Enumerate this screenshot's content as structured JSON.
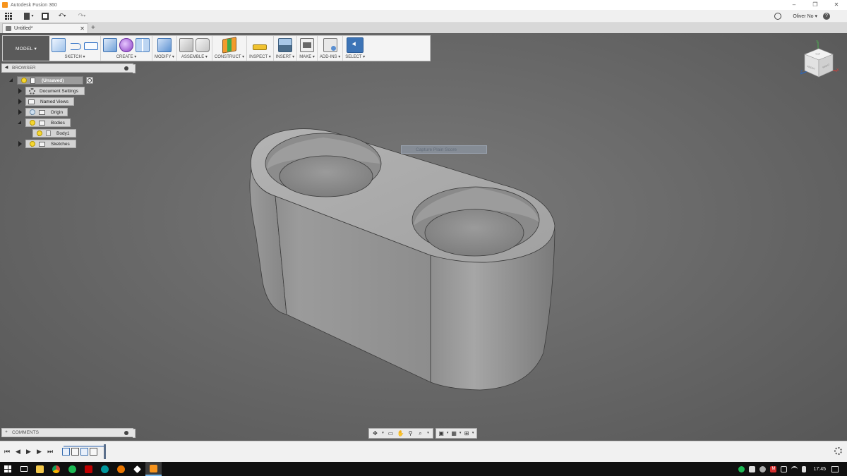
{
  "window": {
    "title": "Autodesk Fusion 360",
    "controls": [
      "–",
      "❐",
      "✕"
    ]
  },
  "quick_access": {
    "user": "Oliver No ▾",
    "help": "?",
    "file_caret": "▾",
    "undo_caret": "▾",
    "redo_caret": "▾"
  },
  "tabs": {
    "doc_tab": "Untitled*",
    "close": "✕",
    "add": "+"
  },
  "toolbar": {
    "workspace": "MODEL ▾",
    "groups": [
      "SKETCH ▾",
      "CREATE ▾",
      "MODIFY ▾",
      "ASSEMBLE ▾",
      "CONSTRUCT ▾",
      "INSPECT ▾",
      "INSERT ▾",
      "MAKE ▾",
      "ADD-INS ▾",
      "SELECT ▾"
    ]
  },
  "browser": {
    "title": "BROWSER",
    "items": [
      {
        "label": "(Unsaved)"
      },
      {
        "label": "Document Settings"
      },
      {
        "label": "Named Views"
      },
      {
        "label": "Origin"
      },
      {
        "label": "Bodies"
      },
      {
        "label": "Body1"
      },
      {
        "label": "Sketches"
      }
    ]
  },
  "comments": {
    "title": "COMMENTS"
  },
  "viewcube": {
    "faces": [
      "TOP",
      "FRONT",
      "RIGHT"
    ],
    "axes": [
      "Y",
      "X",
      "Z"
    ]
  },
  "tooltip": {
    "text": "Capture Plain Score"
  },
  "taskbar": {
    "time": "17:45",
    "tray_letter": "M"
  },
  "colors": {
    "accent": "#3d74b6",
    "canvas_bg": "#6a6a6a",
    "model_grey": "#a3a3a3"
  },
  "icons": {
    "navbar": [
      "orbit-icon",
      "look-at-icon",
      "pan-icon",
      "zoom-icon",
      "fit-icon",
      "display-settings-icon",
      "grid-icon",
      "viewports-icon"
    ],
    "timeline": [
      "first-icon",
      "previous-icon",
      "play-icon",
      "next-icon",
      "last-icon",
      "settings-icon"
    ],
    "taskbar_apps": [
      "task-view-icon",
      "file-explorer-icon",
      "chrome-icon",
      "spotify-icon",
      "filezilla-icon",
      "arduino-icon",
      "blender-icon",
      "inkscape-icon",
      "fusion360-icon"
    ]
  }
}
